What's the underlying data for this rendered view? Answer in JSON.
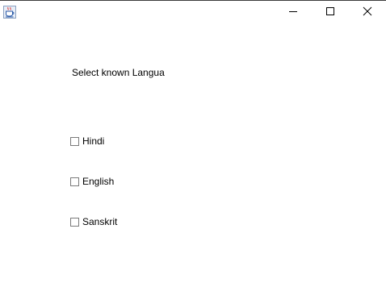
{
  "window": {
    "app_icon": "java-coffee-cup-icon",
    "controls": {
      "minimize_icon": "minimize-icon",
      "maximize_icon": "maximize-icon",
      "close_icon": "close-icon"
    }
  },
  "main": {
    "heading": "Select known Langua",
    "checkboxes": [
      {
        "label": "Hindi",
        "checked": false
      },
      {
        "label": "English",
        "checked": false
      },
      {
        "label": "Sanskrit",
        "checked": false
      }
    ]
  }
}
